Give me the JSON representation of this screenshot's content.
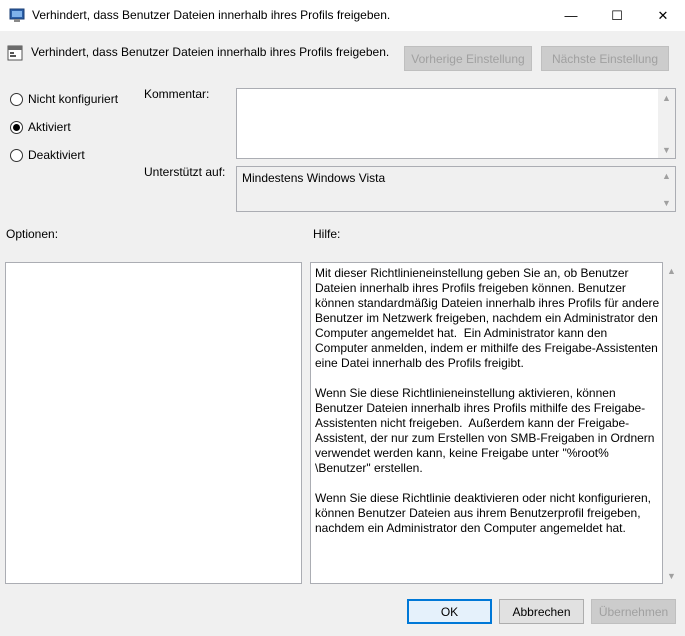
{
  "window": {
    "title": "Verhindert, dass Benutzer Dateien innerhalb ihres Profils freigeben.",
    "minimize_glyph": "—",
    "maximize_glyph": "☐",
    "close_glyph": "✕"
  },
  "header": {
    "title": "Verhindert, dass Benutzer Dateien innerhalb ihres Profils freigeben.",
    "prev_button": "Vorherige Einstellung",
    "next_button": "Nächste Einstellung"
  },
  "state": {
    "options": [
      {
        "label": "Nicht konfiguriert",
        "checked": false
      },
      {
        "label": "Aktiviert",
        "checked": true
      },
      {
        "label": "Deaktiviert",
        "checked": false
      }
    ]
  },
  "comment": {
    "label": "Kommentar:",
    "value": ""
  },
  "supported": {
    "label": "Unterstützt auf:",
    "value": "Mindestens Windows Vista"
  },
  "panels": {
    "options_label": "Optionen:",
    "help_label": "Hilfe:",
    "help_text": "Mit dieser Richtlinieneinstellung geben Sie an, ob Benutzer\nDateien innerhalb ihres Profils freigeben können. Benutzer\nkönnen standardmäßig Dateien innerhalb ihres Profils für andere\nBenutzer im Netzwerk freigeben, nachdem ein Administrator den\nComputer angemeldet hat.  Ein Administrator kann den\nComputer anmelden, indem er mithilfe des Freigabe-Assistenten\neine Datei innerhalb des Profils freigibt.\n\nWenn Sie diese Richtlinieneinstellung aktivieren, können\nBenutzer Dateien innerhalb ihres Profils mithilfe des Freigabe-\nAssistenten nicht freigeben.  Außerdem kann der Freigabe-\nAssistent, der nur zum Erstellen von SMB-Freigaben in Ordnern\nverwendet werden kann, keine Freigabe unter \"%root%\n\\Benutzer\" erstellen.\n\nWenn Sie diese Richtlinie deaktivieren oder nicht konfigurieren,\nkönnen Benutzer Dateien aus ihrem Benutzerprofil freigeben,\nnachdem ein Administrator den Computer angemeldet hat."
  },
  "footer": {
    "ok": "OK",
    "cancel": "Abbrechen",
    "apply": "Übernehmen"
  },
  "icons": {
    "scroll_up": "▲",
    "scroll_down": "▼"
  }
}
